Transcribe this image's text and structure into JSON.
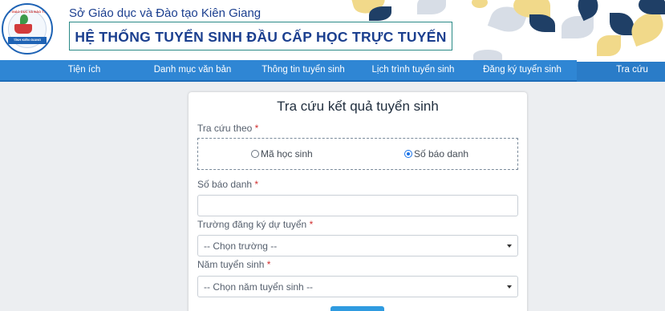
{
  "header": {
    "department": "Sở Giáo dục và Đào tạo Kiên Giang",
    "system_title": "HỆ THỐNG TUYỂN SINH ĐẦU CẤP HỌC TRỰC TUYẾN",
    "logo_text_top": "SỞ GIÁO DỤC VÀ ĐÀO TẠO",
    "logo_text_bottom": "TỈNH KIÊN GIANG"
  },
  "nav": {
    "items": [
      {
        "label": "Tiện ích"
      },
      {
        "label": "Danh mục văn bản"
      },
      {
        "label": "Thông tin tuyển sinh"
      },
      {
        "label": "Lịch trình tuyển sinh"
      },
      {
        "label": "Đăng ký tuyển sinh"
      },
      {
        "label": "Tra cứu"
      }
    ],
    "active_index": 5
  },
  "form": {
    "title": "Tra cứu kết quả tuyển sinh",
    "lookup_by_label": "Tra cứu theo",
    "required_mark": "*",
    "radio_options": [
      {
        "label": "Mã học sinh",
        "checked": false
      },
      {
        "label": "Số báo danh",
        "checked": true
      }
    ],
    "candidate_number_label": "Số báo danh",
    "candidate_number_value": "",
    "school_label": "Trường đăng ký dự tuyển",
    "school_placeholder": "-- Chọn trường --",
    "year_label": "Năm tuyển sinh",
    "year_placeholder": "-- Chọn năm tuyển sinh --"
  },
  "colors": {
    "nav_bg": "#2f86d4",
    "title_blue": "#1b3f8f",
    "title_border": "#2a8a87",
    "required": "#d12f2f",
    "button": "#2f9be0"
  }
}
